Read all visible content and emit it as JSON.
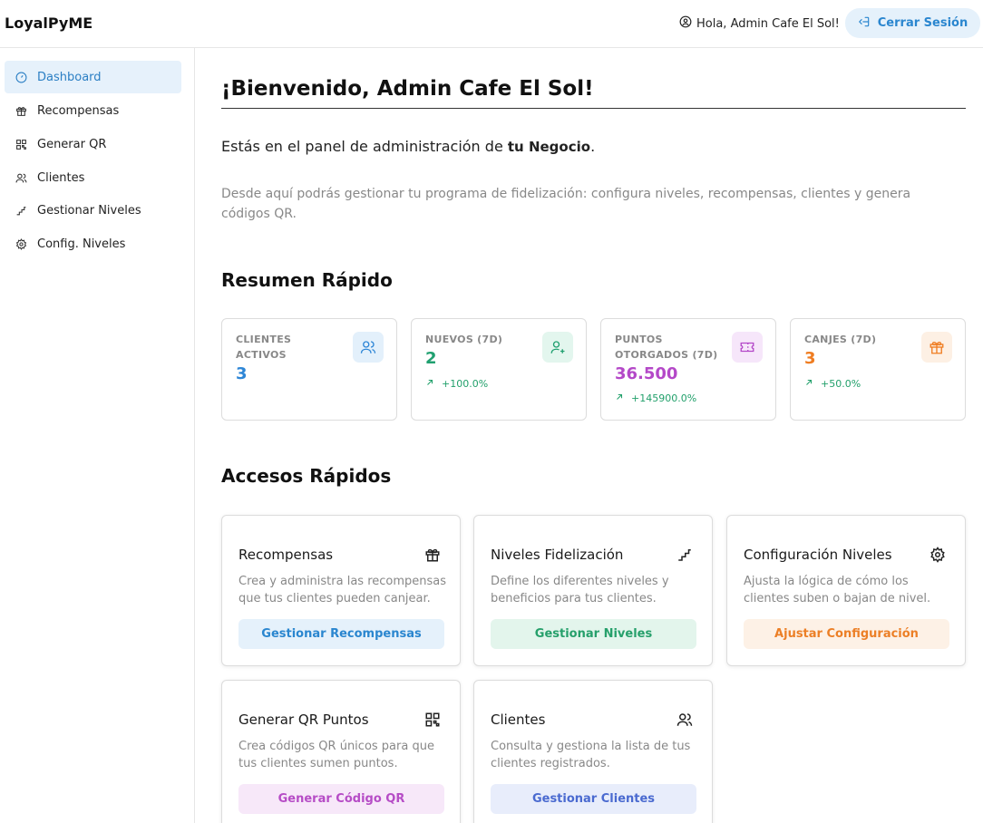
{
  "header": {
    "brand": "LoyalPyME",
    "greeting": "Hola, Admin Cafe El Sol!",
    "logout_label": "Cerrar Sesión"
  },
  "sidebar": {
    "items": [
      {
        "label": "Dashboard",
        "icon": "gauge-icon",
        "active": true
      },
      {
        "label": "Recompensas",
        "icon": "gift-icon"
      },
      {
        "label": "Generar QR",
        "icon": "qr-icon"
      },
      {
        "label": "Clientes",
        "icon": "users-icon"
      },
      {
        "label": "Gestionar Niveles",
        "icon": "stairs-icon"
      },
      {
        "label": "Config. Niveles",
        "icon": "gear-icon"
      }
    ]
  },
  "main": {
    "title": "¡Bienvenido, Admin Cafe El Sol!",
    "lead_prefix": "Estás en el panel de administración de ",
    "lead_business": "tu Negocio",
    "lead_suffix": ".",
    "description": "Desde aquí podrás gestionar tu programa de fidelización: configura niveles, recompensas, clientes y genera códigos QR.",
    "summary_heading": "Resumen Rápido",
    "quick_heading": "Accesos Rápidos"
  },
  "stats": [
    {
      "label": "CLIENTES ACTIVOS",
      "value": "3",
      "delta": "",
      "value_color": "#2e86d6",
      "icon": "users-icon",
      "icon_bg": "#e3f0fb",
      "icon_color": "#2e86d6"
    },
    {
      "label": "NUEVOS (7D)",
      "value": "2",
      "delta": "+100.0%",
      "value_color": "#20a070",
      "icon": "user-plus-icon",
      "icon_bg": "#e3f6ee",
      "icon_color": "#20a070"
    },
    {
      "label": "PUNTOS OTORGADOS (7D)",
      "value": "36.500",
      "delta": "+145900.0%",
      "value_color": "#b448c8",
      "icon": "ticket-icon",
      "icon_bg": "#f6e6fa",
      "icon_color": "#b448c8"
    },
    {
      "label": "CANJES (7D)",
      "value": "3",
      "delta": "+50.0%",
      "value_color": "#ef7d22",
      "icon": "gift-icon",
      "icon_bg": "#fdf0e4",
      "icon_color": "#ef7d22"
    }
  ],
  "quick_access": [
    {
      "title": "Recompensas",
      "description": "Crea y administra las recompensas que tus clientes pueden canjear.",
      "button": "Gestionar Recompensas",
      "icon": "gift-icon",
      "btn_bg": "#e5f1fb",
      "btn_color": "#2a86cf"
    },
    {
      "title": "Niveles Fidelización",
      "description": "Define los diferentes niveles y beneficios para tus clientes.",
      "button": "Gestionar Niveles",
      "icon": "stairs-icon",
      "btn_bg": "#e3f5ec",
      "btn_color": "#26a06b"
    },
    {
      "title": "Configuración Niveles",
      "description": "Ajusta la lógica de cómo los clientes suben o bajan de nivel.",
      "button": "Ajustar Configuración",
      "icon": "gear-icon",
      "btn_bg": "#fdf1e6",
      "btn_color": "#ec7f26"
    },
    {
      "title": "Generar QR Puntos",
      "description": "Crea códigos QR únicos para que tus clientes sumen puntos.",
      "button": "Generar Código QR",
      "icon": "qr-icon",
      "btn_bg": "#f7e8f9",
      "btn_color": "#b64cc6"
    },
    {
      "title": "Clientes",
      "description": "Consulta y gestiona la lista de tus clientes registrados.",
      "button": "Gestionar Clientes",
      "icon": "users-icon",
      "btn_bg": "#e8edfb",
      "btn_color": "#4a6ad0"
    }
  ]
}
